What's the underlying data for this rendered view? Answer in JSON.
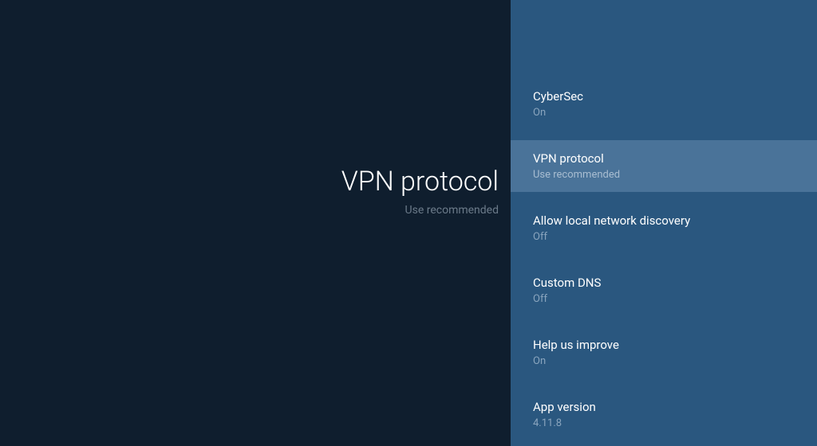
{
  "detail": {
    "title": "VPN protocol",
    "subtitle": "Use recommended"
  },
  "menu": {
    "items": [
      {
        "title": "CyberSec",
        "value": "On",
        "selected": false
      },
      {
        "title": "VPN protocol",
        "value": "Use recommended",
        "selected": true
      },
      {
        "title": "Allow local network discovery",
        "value": "Off",
        "selected": false
      },
      {
        "title": "Custom DNS",
        "value": "Off",
        "selected": false
      },
      {
        "title": "Help us improve",
        "value": "On",
        "selected": false
      },
      {
        "title": "App version",
        "value": "4.11.8",
        "selected": false
      }
    ]
  }
}
